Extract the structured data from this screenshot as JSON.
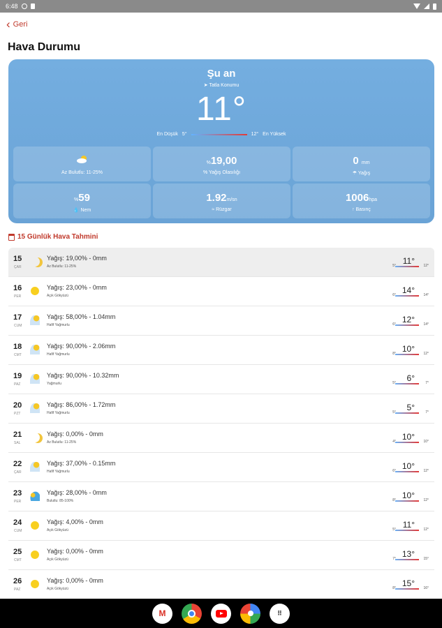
{
  "status": {
    "time": "6:48"
  },
  "nav": {
    "back_label": "Geri",
    "back_glyph": "‹"
  },
  "page": {
    "title": "Hava Durumu"
  },
  "current": {
    "heading": "Şu an",
    "location": "Tatla Konumu",
    "location_glyph": "➤",
    "temp": "11°",
    "low_label": "En Düşük",
    "low": "5°",
    "high": "12°",
    "high_label": "En Yüksek",
    "tiles": [
      {
        "icon": "partly-cloudy-icon",
        "value": "",
        "unit": "",
        "label": "Az Bulutlu: 11-25%"
      },
      {
        "icon": "",
        "prefix": "%",
        "value": "19,00",
        "unit": "",
        "label": "% Yağış Olasılığı"
      },
      {
        "icon": "rain-icon",
        "prefix": "",
        "value": "0",
        "unit": "mm",
        "label": "Yağış"
      },
      {
        "icon": "humidity-icon",
        "prefix": "%",
        "value": "59",
        "unit": "",
        "label": "Nem"
      },
      {
        "icon": "wind-icon",
        "prefix": "",
        "value": "1.92",
        "unit": "m/sn",
        "label": "Rüzgar"
      },
      {
        "icon": "pressure-icon",
        "prefix": "",
        "value": "1006",
        "unit": "hpa",
        "label": "Basınç"
      }
    ],
    "tile_glyphs": {
      "humidity": "💧",
      "wind": "≈",
      "pressure": "↑",
      "rain": "☂"
    }
  },
  "forecast": {
    "title": "15 Günlük Hava Tahmini",
    "days": [
      {
        "day": "15",
        "weekday": "ÇAR",
        "icon": "moon-icon",
        "precip": "Yağış: 19,00% - 0mm",
        "cond": "Az Bulutlu: 11-25%",
        "low": "5°",
        "temp": "11°",
        "high": "12°"
      },
      {
        "day": "16",
        "weekday": "PER",
        "icon": "sun-icon",
        "precip": "Yağış: 23,00% - 0mm",
        "cond": "Açık Gökyüzü",
        "low": "6°",
        "temp": "14°",
        "high": "14°"
      },
      {
        "day": "17",
        "weekday": "CUM",
        "icon": "rain-cloud-icon",
        "precip": "Yağış: 58,00% - 1.04mm",
        "cond": "Hafif Yağmurlu",
        "low": "6°",
        "temp": "12°",
        "high": "14°"
      },
      {
        "day": "18",
        "weekday": "CMT",
        "icon": "rain-cloud-icon",
        "precip": "Yağış: 90,00% - 2.06mm",
        "cond": "Hafif Yağmurlu",
        "low": "8°",
        "temp": "10°",
        "high": "12°"
      },
      {
        "day": "19",
        "weekday": "PAZ",
        "icon": "rain-cloud-icon",
        "precip": "Yağış: 90,00% - 10.32mm",
        "cond": "Yağmurlu",
        "low": "5°",
        "temp": "6°",
        "high": "7°"
      },
      {
        "day": "20",
        "weekday": "PZT",
        "icon": "rain-cloud-icon",
        "precip": "Yağış: 86,00% - 1.72mm",
        "cond": "Hafif Yağmurlu",
        "low": "5°",
        "temp": "5°",
        "high": "7°"
      },
      {
        "day": "21",
        "weekday": "SAL",
        "icon": "moon-icon",
        "precip": "Yağış: 0,00% - 0mm",
        "cond": "Az Bulutlu: 11-25%",
        "low": "4°",
        "temp": "10°",
        "high": "10°"
      },
      {
        "day": "22",
        "weekday": "ÇAR",
        "icon": "rain-cloud-icon",
        "precip": "Yağış: 37,00% - 0.15mm",
        "cond": "Hafif Yağmurlu",
        "low": "6°",
        "temp": "10°",
        "high": "12°"
      },
      {
        "day": "23",
        "weekday": "PER",
        "icon": "cloudy-icon",
        "precip": "Yağış: 28,00% - 0mm",
        "cond": "Bulutlu: 85-100%",
        "low": "8°",
        "temp": "10°",
        "high": "12°"
      },
      {
        "day": "24",
        "weekday": "CUM",
        "icon": "sun-icon",
        "precip": "Yağış: 4,00% - 0mm",
        "cond": "Açık Gökyüzü",
        "low": "5°",
        "temp": "11°",
        "high": "12°"
      },
      {
        "day": "25",
        "weekday": "CMT",
        "icon": "sun-icon",
        "precip": "Yağış: 0,00% - 0mm",
        "cond": "Açık Gökyüzü",
        "low": "7°",
        "temp": "13°",
        "high": "15°"
      },
      {
        "day": "26",
        "weekday": "PAZ",
        "icon": "sun-icon",
        "precip": "Yağış: 0,00% - 0mm",
        "cond": "Açık Gökyüzü",
        "low": "8°",
        "temp": "15°",
        "high": "16°"
      }
    ]
  },
  "taskbar": {
    "apps": [
      {
        "name": "gmail",
        "glyph": "M"
      },
      {
        "name": "chrome",
        "glyph": ""
      },
      {
        "name": "youtube",
        "glyph": ""
      },
      {
        "name": "photos",
        "glyph": ""
      },
      {
        "name": "app-drawer",
        "glyph": "⠿"
      }
    ]
  },
  "colors": {
    "accent": "#c0392b",
    "hero": "#6aa3d6"
  }
}
